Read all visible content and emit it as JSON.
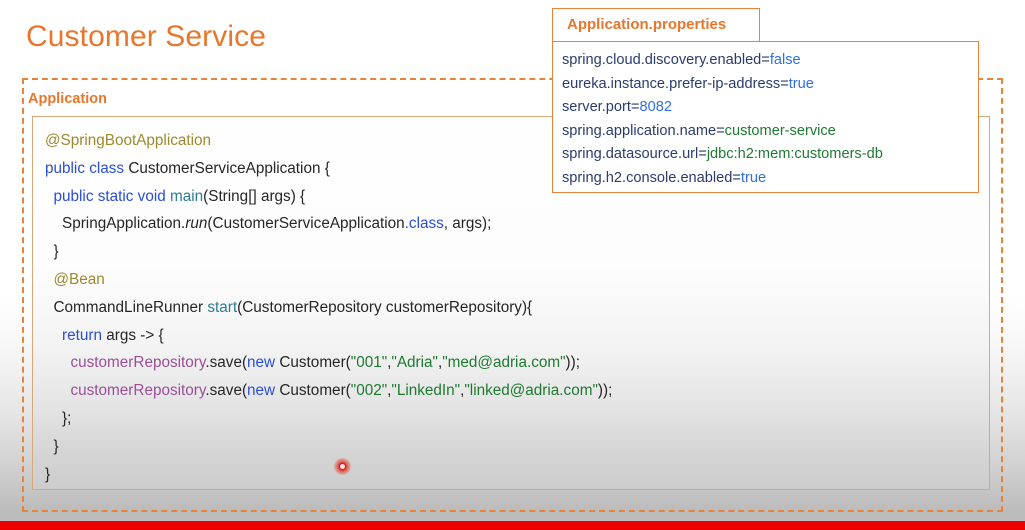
{
  "slide": {
    "title": "Customer Service",
    "accent_color": "#E8762C",
    "dashed_border_color": "#E8833C",
    "bottom_bar_color": "#ED0000"
  },
  "application_box": {
    "label": "Application"
  },
  "code": {
    "lines": [
      [
        {
          "t": "@SpringBootApplication",
          "c": "anno"
        }
      ],
      [
        {
          "t": "public class ",
          "c": "kw"
        },
        {
          "t": "CustomerServiceApplication {",
          "c": "plain"
        }
      ],
      [
        {
          "t": "  ",
          "c": "plain"
        },
        {
          "t": "public static void ",
          "c": "kw"
        },
        {
          "t": "main",
          "c": "meth"
        },
        {
          "t": "(String[] args) {",
          "c": "plain"
        }
      ],
      [
        {
          "t": "    SpringApplication.",
          "c": "plain"
        },
        {
          "t": "run",
          "c": "ital"
        },
        {
          "t": "(CustomerServiceApplication",
          "c": "plain"
        },
        {
          "t": ".class",
          "c": "kw"
        },
        {
          "t": ", args);",
          "c": "plain"
        }
      ],
      [
        {
          "t": "  }",
          "c": "plain"
        }
      ],
      [
        {
          "t": "  ",
          "c": "plain"
        },
        {
          "t": "@Bean",
          "c": "anno"
        }
      ],
      [
        {
          "t": "  CommandLineRunner ",
          "c": "plain"
        },
        {
          "t": "start",
          "c": "meth"
        },
        {
          "t": "(CustomerRepository customerRepository){",
          "c": "plain"
        }
      ],
      [
        {
          "t": "    ",
          "c": "plain"
        },
        {
          "t": "return",
          "c": "kw"
        },
        {
          "t": " args -> {",
          "c": "plain"
        }
      ],
      [
        {
          "t": "      ",
          "c": "plain"
        },
        {
          "t": "customerRepository",
          "c": "purp"
        },
        {
          "t": ".save(",
          "c": "plain"
        },
        {
          "t": "new",
          "c": "kw"
        },
        {
          "t": " Customer(",
          "c": "plain"
        },
        {
          "t": "\"001\"",
          "c": "str"
        },
        {
          "t": ",",
          "c": "plain"
        },
        {
          "t": "\"Adria\"",
          "c": "str"
        },
        {
          "t": ",",
          "c": "plain"
        },
        {
          "t": "\"med@adria.com\"",
          "c": "str"
        },
        {
          "t": "));",
          "c": "plain"
        }
      ],
      [
        {
          "t": "      ",
          "c": "plain"
        },
        {
          "t": "customerRepository",
          "c": "purp"
        },
        {
          "t": ".save(",
          "c": "plain"
        },
        {
          "t": "new",
          "c": "kw"
        },
        {
          "t": " Customer(",
          "c": "plain"
        },
        {
          "t": "\"002\"",
          "c": "str"
        },
        {
          "t": ",",
          "c": "plain"
        },
        {
          "t": "\"LinkedIn\"",
          "c": "str"
        },
        {
          "t": ",",
          "c": "plain"
        },
        {
          "t": "\"linked@adria.com\"",
          "c": "str"
        },
        {
          "t": "));",
          "c": "plain"
        }
      ],
      [
        {
          "t": "    };",
          "c": "plain"
        }
      ],
      [
        {
          "t": "  }",
          "c": "plain"
        }
      ],
      [
        {
          "t": "}",
          "c": "plain"
        }
      ]
    ]
  },
  "properties_callout": {
    "tab_label": "Application.properties",
    "lines": [
      [
        {
          "t": "spring.cloud.discovery.enabled=",
          "c": "pkey"
        },
        {
          "t": "false",
          "c": "pval-blue"
        }
      ],
      [
        {
          "t": "eureka.instance.prefer-ip-address=",
          "c": "pkey"
        },
        {
          "t": "true",
          "c": "pval-blue"
        }
      ],
      [
        {
          "t": "server.port=",
          "c": "pkey"
        },
        {
          "t": "8082",
          "c": "pval-blue"
        }
      ],
      [
        {
          "t": "spring.application.name=",
          "c": "pkey"
        },
        {
          "t": "customer-service",
          "c": "pval-green"
        }
      ],
      [
        {
          "t": "spring.datasource.url=",
          "c": "pkey"
        },
        {
          "t": "jdbc:h2:mem:customers-db",
          "c": "pval-green"
        }
      ],
      [
        {
          "t": "spring.h2.console.enabled=",
          "c": "pkey"
        },
        {
          "t": "true",
          "c": "pval-blue"
        }
      ]
    ]
  },
  "pointer": {
    "icon": "laser-pointer-dot",
    "color": "#E01010"
  }
}
